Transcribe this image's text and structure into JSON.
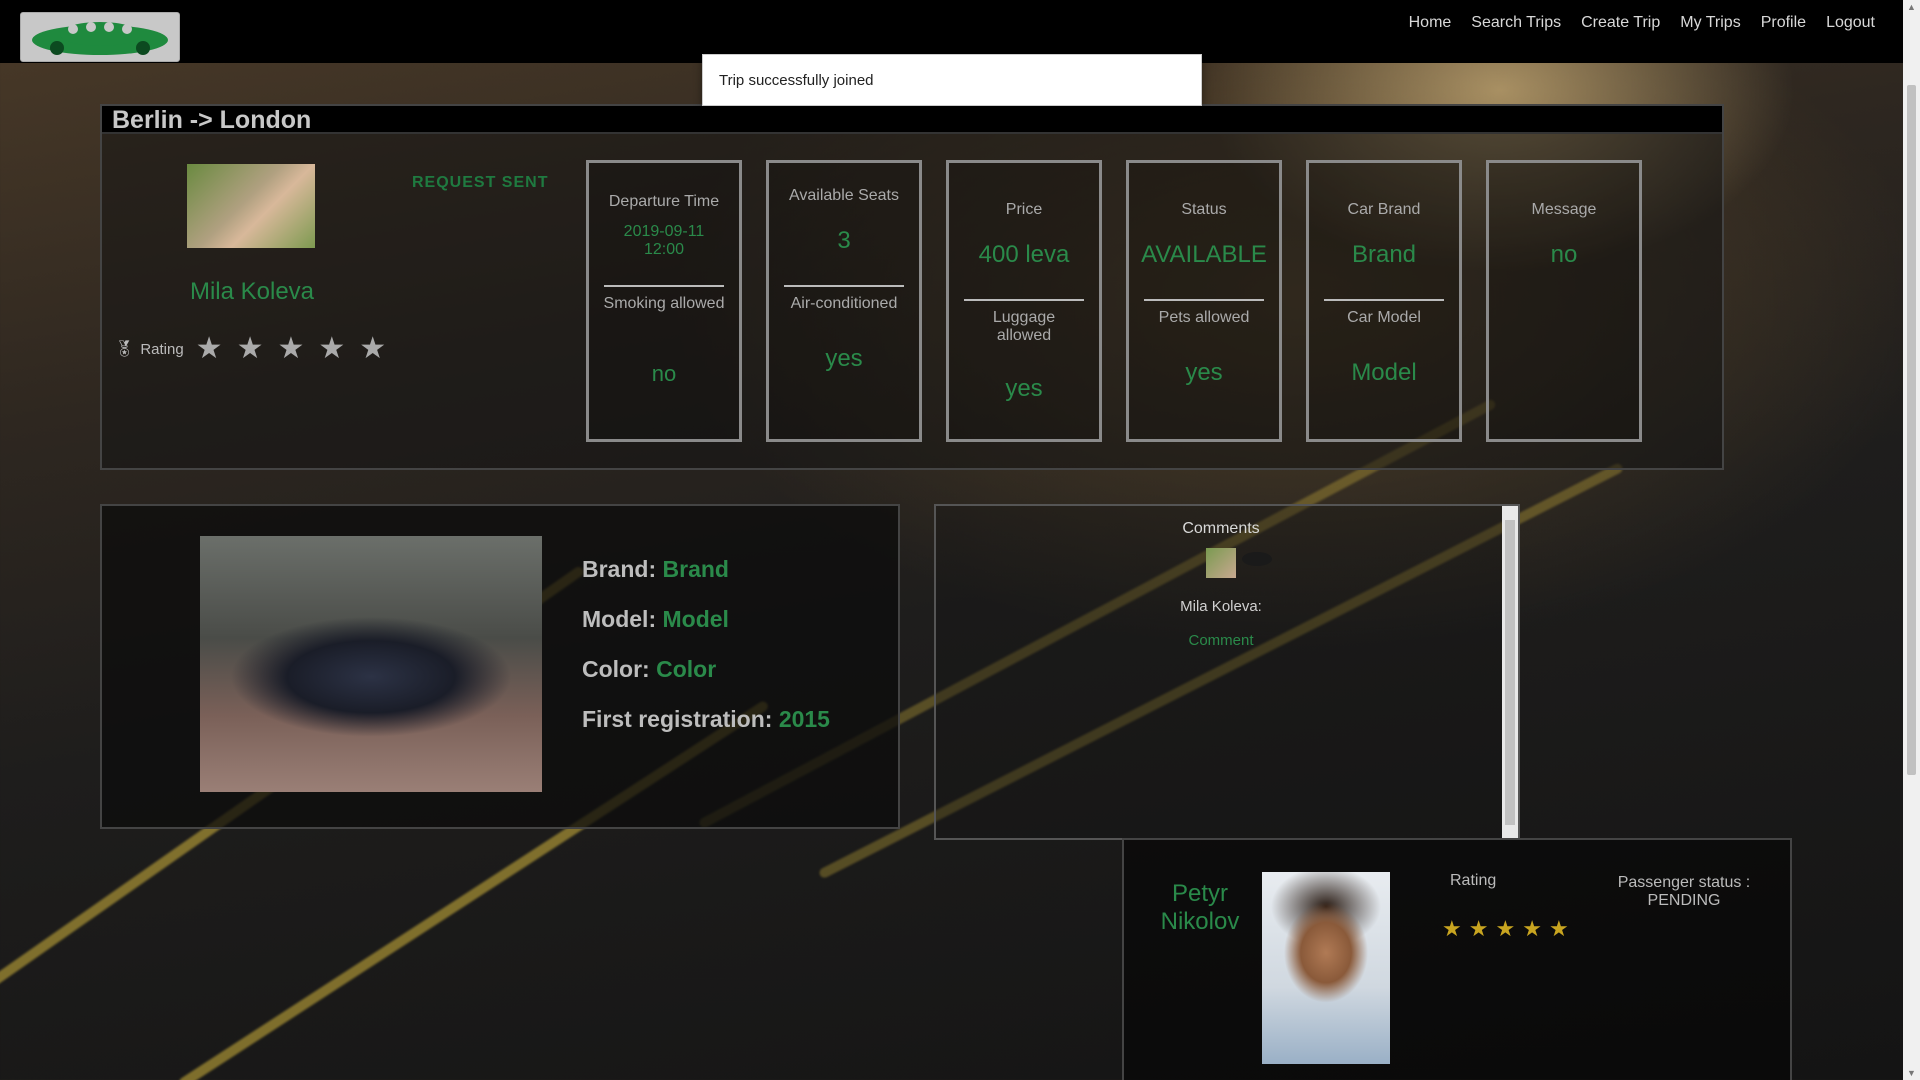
{
  "navbar": {
    "links": [
      "Home",
      "Search Trips",
      "Create Trip",
      "My Trips",
      "Profile",
      "Logout"
    ]
  },
  "toast": {
    "message": "Trip successfully joined"
  },
  "trip": {
    "title": "Berlin -> London",
    "driver": {
      "name": "Mila Koleva",
      "rating_label": "Rating",
      "rating_stars": 5
    },
    "request_status": "REQUEST SENT",
    "cards": [
      {
        "top_label": "Departure Time",
        "top_value": "2019-09-11 12:00",
        "bottom_label": "Smoking allowed",
        "bottom_value": "no"
      },
      {
        "top_label": "Available Seats",
        "top_value": "3",
        "bottom_label": "Air-conditioned",
        "bottom_value": "yes"
      },
      {
        "top_label": "Price",
        "top_value": "400 leva",
        "bottom_label": "Luggage allowed",
        "bottom_value": "yes"
      },
      {
        "top_label": "Status",
        "top_value": "AVAILABLE",
        "bottom_label": "Pets allowed",
        "bottom_value": "yes"
      },
      {
        "top_label": "Car Brand",
        "top_value": "Brand",
        "bottom_label": "Car Model",
        "bottom_value": "Model"
      },
      {
        "top_label": "Message",
        "top_value": "no"
      }
    ]
  },
  "car": {
    "brand_label": "Brand:",
    "brand": "Brand",
    "model_label": "Model:",
    "model": "Model",
    "color_label": "Color:",
    "color": "Color",
    "registration_label": "First registration:",
    "registration": "2015"
  },
  "comments": {
    "title": "Comments",
    "items": [
      {
        "author": "Mila Koleva:",
        "text": "Comment"
      }
    ]
  },
  "passenger": {
    "name": "Petyr Nikolov",
    "rating_label": "Rating",
    "rating_stars": 5,
    "status_label": "Passenger status :",
    "status": "PENDING"
  },
  "colors": {
    "accent_green": "#2a8a4a",
    "star_gold": "#c9a520"
  }
}
